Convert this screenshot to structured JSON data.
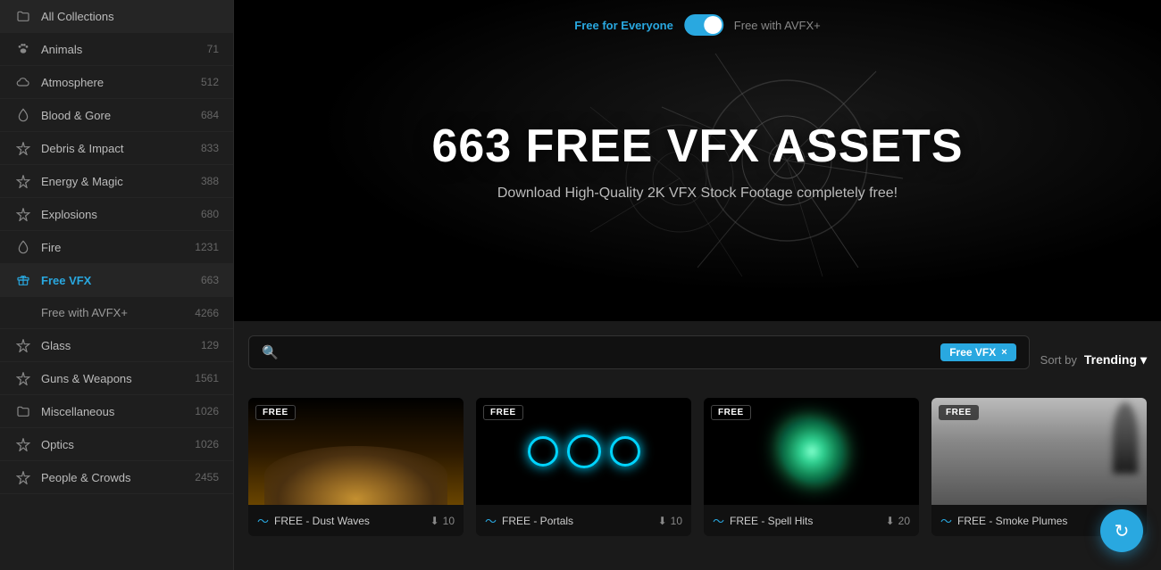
{
  "sidebar": {
    "items": [
      {
        "id": "all-collections",
        "label": "All Collections",
        "count": "",
        "icon": "folder",
        "active": false
      },
      {
        "id": "animals",
        "label": "Animals",
        "count": "71",
        "icon": "paw",
        "active": false
      },
      {
        "id": "atmosphere",
        "label": "Atmosphere",
        "count": "512",
        "icon": "cloud",
        "active": false
      },
      {
        "id": "blood-gore",
        "label": "Blood & Gore",
        "count": "684",
        "icon": "drop",
        "active": false
      },
      {
        "id": "debris-impact",
        "label": "Debris & Impact",
        "count": "833",
        "icon": "star4",
        "active": false
      },
      {
        "id": "energy-magic",
        "label": "Energy & Magic",
        "count": "388",
        "icon": "sparkle",
        "active": false
      },
      {
        "id": "explosions",
        "label": "Explosions",
        "count": "680",
        "icon": "sparkle",
        "active": false
      },
      {
        "id": "fire",
        "label": "Fire",
        "count": "1231",
        "icon": "flame",
        "active": false
      },
      {
        "id": "free-vfx",
        "label": "Free VFX",
        "count": "663",
        "icon": "gift",
        "active": true
      },
      {
        "id": "free-avfx",
        "label": "Free with AVFX+",
        "count": "4266",
        "icon": "",
        "active": false,
        "sub": true
      },
      {
        "id": "glass",
        "label": "Glass",
        "count": "129",
        "icon": "sparkle",
        "active": false
      },
      {
        "id": "guns-weapons",
        "label": "Guns & Weapons",
        "count": "1561",
        "icon": "sparkle",
        "active": false
      },
      {
        "id": "miscellaneous",
        "label": "Miscellaneous",
        "count": "1026",
        "icon": "folder",
        "active": false
      },
      {
        "id": "optics",
        "label": "Optics",
        "count": "1026",
        "icon": "sparkle",
        "active": false
      },
      {
        "id": "people-crowds",
        "label": "People & Crowds",
        "count": "2455",
        "icon": "sparkle",
        "active": false
      }
    ]
  },
  "hero": {
    "toggle_left": "Free for Everyone",
    "toggle_right": "Free with AVFX+",
    "title": "663 FREE VFX ASSETS",
    "subtitle": "Download High-Quality 2K VFX Stock Footage completely free!"
  },
  "search": {
    "placeholder": "Search...",
    "filter_tag": "Free VFX",
    "filter_close": "×"
  },
  "sort": {
    "label": "Sort by",
    "value": "Trending",
    "chevron": "▾"
  },
  "assets": [
    {
      "id": "dust-waves",
      "badge": "FREE",
      "name": "FREE - Dust Waves",
      "count": "10",
      "type": "dust"
    },
    {
      "id": "portals",
      "badge": "FREE",
      "name": "FREE - Portals",
      "count": "10",
      "type": "portals"
    },
    {
      "id": "spell-hits",
      "badge": "FREE",
      "name": "FREE - Spell Hits",
      "count": "20",
      "type": "spell"
    },
    {
      "id": "smoke-plumes",
      "badge": "FREE",
      "name": "FREE - Smoke Plumes",
      "count": "",
      "type": "smoke"
    }
  ],
  "fab": {
    "icon": "↻"
  }
}
